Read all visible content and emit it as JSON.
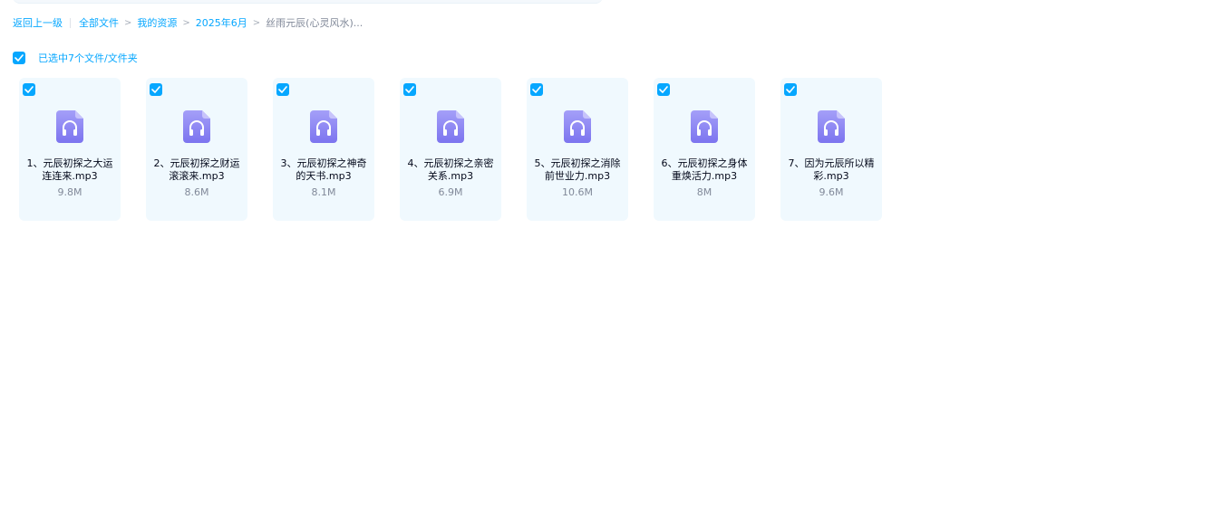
{
  "breadcrumb": {
    "back_label": "返回上一级",
    "items": [
      "全部文件",
      "我的资源",
      "2025年6月"
    ],
    "current": "丝雨元辰(心灵风水)...",
    "separator": ">"
  },
  "selection": {
    "label": "已选中7个文件/文件夹",
    "checked": true
  },
  "files": [
    {
      "name": "1、元辰初探之大运连连来.mp3",
      "size": "9.8M",
      "icon": "audio-file-icon",
      "checked": true
    },
    {
      "name": "2、元辰初探之财运滚滚来.mp3",
      "size": "8.6M",
      "icon": "audio-file-icon",
      "checked": true
    },
    {
      "name": "3、元辰初探之神奇的天书.mp3",
      "size": "8.1M",
      "icon": "audio-file-icon",
      "checked": true
    },
    {
      "name": "4、元辰初探之亲密关系.mp3",
      "size": "6.9M",
      "icon": "audio-file-icon",
      "checked": true
    },
    {
      "name": "5、元辰初探之消除前世业力.mp3",
      "size": "10.6M",
      "icon": "audio-file-icon",
      "checked": true
    },
    {
      "name": "6、元辰初探之身体重焕活力.mp3",
      "size": "8M",
      "icon": "audio-file-icon",
      "checked": true
    },
    {
      "name": "7、因为元辰所以精彩.mp3",
      "size": "9.6M",
      "icon": "audio-file-icon",
      "checked": true
    }
  ],
  "colors": {
    "accent": "#06a7ff",
    "card_background": "#f0f9fe",
    "icon_purple": "#8a84f4",
    "text_primary": "#03081a",
    "text_secondary": "#818999"
  }
}
